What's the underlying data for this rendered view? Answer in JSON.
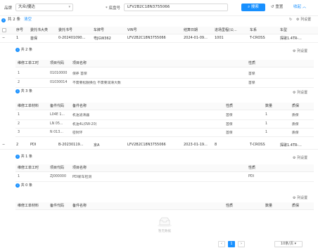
{
  "search": {
    "brand_label": "品牌",
    "brand_value": "大众/捷达",
    "vin_label": "* 底盘号",
    "vin_value": "LFV2B2C18N3755066",
    "search_button": "搜索",
    "reset_button": "重置",
    "collapse_button": "收起"
  },
  "summary": {
    "total_text": "共 2 条",
    "clear_link": "清空",
    "refresh_label": "刷新",
    "column_settings": "列设置"
  },
  "main_table": {
    "headers": [
      "序号",
      "委托书大类",
      "委托书号",
      "车牌号",
      "VIN号",
      "结算日期",
      "进场里程(公...",
      "车系",
      "车型"
    ],
    "rows": [
      {
        "seq": "1",
        "category": "首保",
        "order_no": "0-202401090...",
        "plate": "粤JGW362",
        "vin": "LFV2B2C18N3755066",
        "date": "2024-01-09...",
        "mileage": "1001",
        "series": "T-CROSS",
        "model": "探歌1.4TR-..."
      },
      {
        "seq": "2",
        "category": "PDI",
        "order_no": "B-20230119...",
        "plate": "京A",
        "vin": "LFV2B2C18N3755066",
        "date": "2023-01-19...",
        "mileage": "8",
        "series": "T-CROSS",
        "model": "探歌1.4TR-..."
      }
    ]
  },
  "sub1_labor": {
    "count": "共 2 条",
    "column_settings": "列设置",
    "headers": [
      "维修工单工时",
      "项目代码",
      "项目名称",
      "性质"
    ],
    "rows": [
      {
        "seq": "1",
        "code": "01010000",
        "name": "保养 首保",
        "nature": "首保"
      },
      {
        "seq": "2",
        "code": "01030014",
        "name": "不需要松脱换位 不需要润滑大数",
        "nature": "首保"
      }
    ]
  },
  "sub1_parts": {
    "count": "共 3 条",
    "column_settings": "列设置",
    "headers": [
      "维修工单材料",
      "备件代码",
      "备件名称",
      "性质",
      "数量",
      "质保"
    ],
    "rows": [
      {
        "seq": "1",
        "code": "L04E 1...",
        "name": "机油滤清器",
        "nature": "首保",
        "qty": "1",
        "warranty": "质保"
      },
      {
        "seq": "2",
        "code": "LN 05...",
        "name": "机油4L(0W-20)",
        "nature": "首保",
        "qty": "1",
        "warranty": "质保"
      },
      {
        "seq": "3",
        "code": "N 013...",
        "name": "密封环",
        "nature": "首保",
        "qty": "1",
        "warranty": "质保"
      }
    ]
  },
  "sub2_labor": {
    "count": "共 1 条",
    "column_settings": "列设置",
    "headers": [
      "维修工单工时",
      "项目代码",
      "项目名称",
      "性质"
    ],
    "rows": [
      {
        "seq": "1",
        "code": "ZJ000000",
        "name": "PDI新车检测",
        "nature": "PDI"
      }
    ]
  },
  "sub2_parts": {
    "count": "共 0 条",
    "column_settings": "列设置",
    "headers": [
      "维修工单材料",
      "备件代码",
      "备件名称",
      "性质",
      "数量",
      "质保"
    ],
    "empty_text": "暂无数据"
  },
  "pager": {
    "page": "1",
    "per_page": "10条/页"
  },
  "colors": {
    "accent": "#1890ff"
  }
}
